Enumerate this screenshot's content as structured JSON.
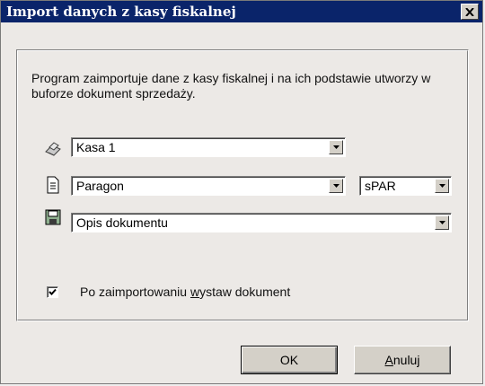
{
  "window": {
    "title": "Import danych z kasy fiskalnej"
  },
  "description": "Program zaimportuje dane z kasy fiskalnej i na ich podstawie utworzy w buforze dokument sprzedaży.",
  "fields": {
    "register": {
      "value": "Kasa 1",
      "icon": "cash-register-icon"
    },
    "doc_type": {
      "value": "Paragon",
      "icon": "document-icon"
    },
    "series": {
      "value": "sPAR"
    },
    "doc_desc": {
      "value": "Opis dokumentu",
      "icon": "save-icon"
    }
  },
  "checkbox": {
    "checked": true,
    "label_before": "Po zaimportowaniu ",
    "label_underlined": "w",
    "label_after": "ystaw dokument"
  },
  "buttons": {
    "ok": "OK",
    "cancel_underlined": "A",
    "cancel_rest": "nuluj"
  }
}
